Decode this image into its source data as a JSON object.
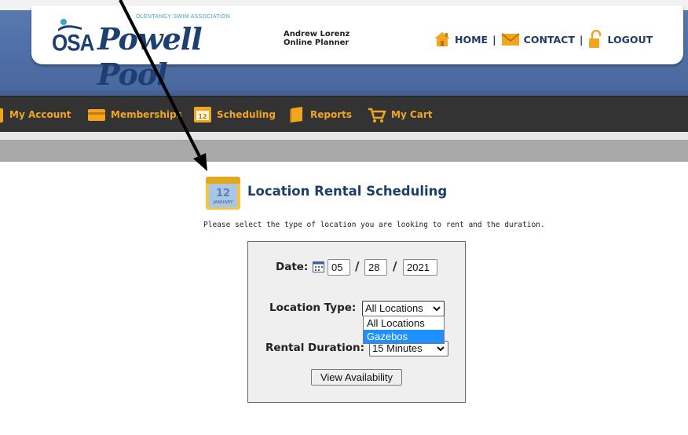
{
  "header": {
    "logo_tagline": "OLENTANGY SWIM ASSOCIATION",
    "logo_abbr": "OSA",
    "logo_name": "Powell Pool",
    "user_name": "Andrew Lorenz",
    "user_role": "Online Planner",
    "links": [
      {
        "label": "HOME",
        "icon": "home-icon"
      },
      {
        "label": "CONTACT",
        "icon": "envelope-icon"
      },
      {
        "label": "LOGOUT",
        "icon": "padlock-icon"
      }
    ],
    "separator": "|"
  },
  "nav": {
    "items": [
      {
        "label": "My Account",
        "icon": "user-icon"
      },
      {
        "label": "Memberships",
        "icon": "card-icon"
      },
      {
        "label": "Scheduling",
        "icon": "calendar-icon"
      },
      {
        "label": "Reports",
        "icon": "book-icon"
      },
      {
        "label": "My Cart",
        "icon": "cart-icon"
      }
    ]
  },
  "page": {
    "icon_day": "12",
    "icon_month": "JANUARY",
    "title": "Location Rental Scheduling",
    "instructions": "Please select the type of location you are looking to rent and the duration."
  },
  "form": {
    "date_label": "Date:",
    "month": "05",
    "day": "28",
    "year": "2021",
    "date_separator": "/",
    "location_type_label": "Location Type:",
    "location_type_value": "All Locations",
    "location_options": [
      "All Locations",
      "Gazebos"
    ],
    "highlighted_option": "Gazebos",
    "rental_duration_label": "Rental Duration:",
    "rental_duration_value": "15 Minutes",
    "view_button": "View Availability"
  },
  "colors": {
    "nav_bg": "#333333",
    "nav_text": "#f3a51f",
    "header_blue": "#4d6ea6",
    "title_navy": "#1d3f66",
    "highlight": "#1e90ff"
  }
}
